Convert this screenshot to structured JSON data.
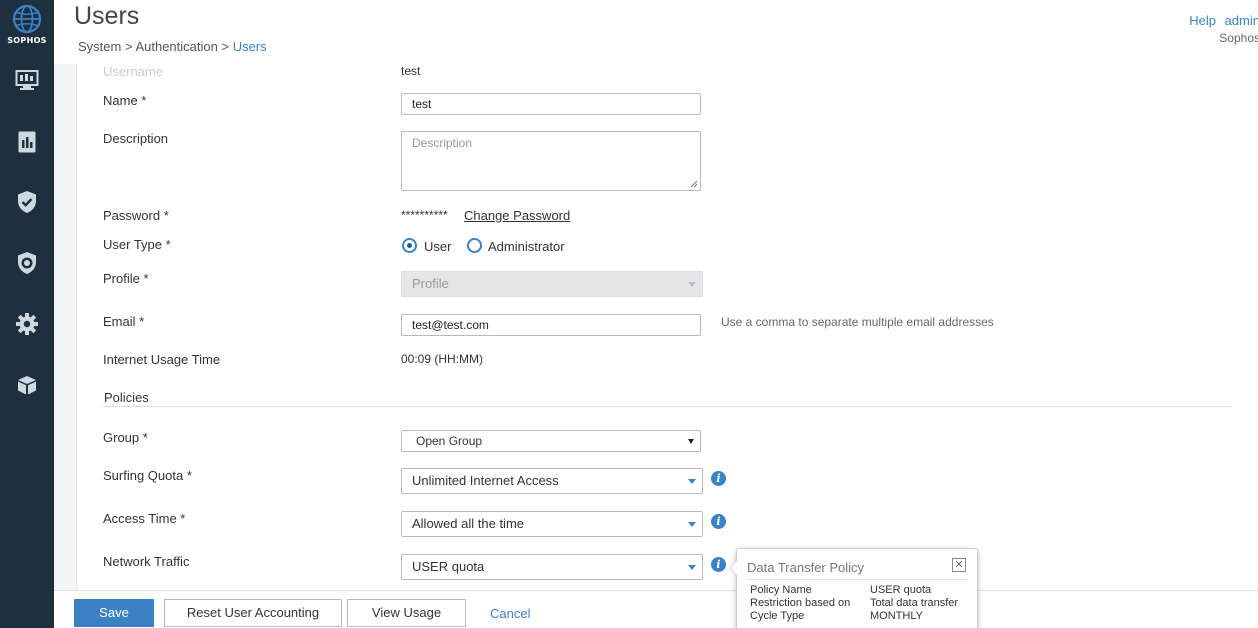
{
  "sidebar": {
    "logo_text": "SOPHOS",
    "items": [
      {
        "icon": "monitor-icon"
      },
      {
        "icon": "reports-icon"
      },
      {
        "icon": "shield-icon"
      },
      {
        "icon": "protect-icon"
      },
      {
        "icon": "gear-icon"
      },
      {
        "icon": "box-icon"
      }
    ]
  },
  "header": {
    "title": "Users",
    "breadcrumb": {
      "part1": "System",
      "sep1": " > ",
      "part2": "Authentication",
      "sep2": " > ",
      "current": "Users"
    },
    "help": "Help",
    "admin": "admin",
    "company": "Sophos"
  },
  "form": {
    "username": {
      "label": "Username",
      "value": "test"
    },
    "name": {
      "label": "Name *",
      "value": "test"
    },
    "description": {
      "label": "Description",
      "placeholder": "Description"
    },
    "password": {
      "label": "Password *",
      "value": "**********",
      "change_link": "Change Password"
    },
    "user_type": {
      "label": "User Type *",
      "options": [
        "User",
        "Administrator"
      ],
      "selected": "User"
    },
    "profile": {
      "label": "Profile *",
      "value": "Profile"
    },
    "email": {
      "label": "Email *",
      "value": "test@test.com",
      "hint": "Use a comma to separate multiple email addresses"
    },
    "usage_time": {
      "label": "Internet Usage Time",
      "value": "00:09 (HH:MM)"
    },
    "policies_title": "Policies",
    "group": {
      "label": "Group *",
      "value": "Open Group"
    },
    "surfing_quota": {
      "label": "Surfing Quota *",
      "value": "Unlimited Internet Access"
    },
    "access_time": {
      "label": "Access Time *",
      "value": "Allowed all the time"
    },
    "network_traffic": {
      "label": "Network Traffic",
      "value": "USER quota"
    }
  },
  "footer": {
    "save": "Save",
    "reset": "Reset User Accounting",
    "view_usage": "View Usage",
    "cancel": "Cancel"
  },
  "tooltip": {
    "title": "Data Transfer Policy",
    "close": "✕",
    "rows": [
      {
        "key": "Policy Name",
        "value": "USER quota"
      },
      {
        "key": "Restriction based on",
        "value": "Total data transfer"
      },
      {
        "key": "Cycle Type",
        "value": "MONTHLY"
      }
    ]
  },
  "colors": {
    "sidebar": "#1e2f3d",
    "accent": "#3b82c4"
  }
}
